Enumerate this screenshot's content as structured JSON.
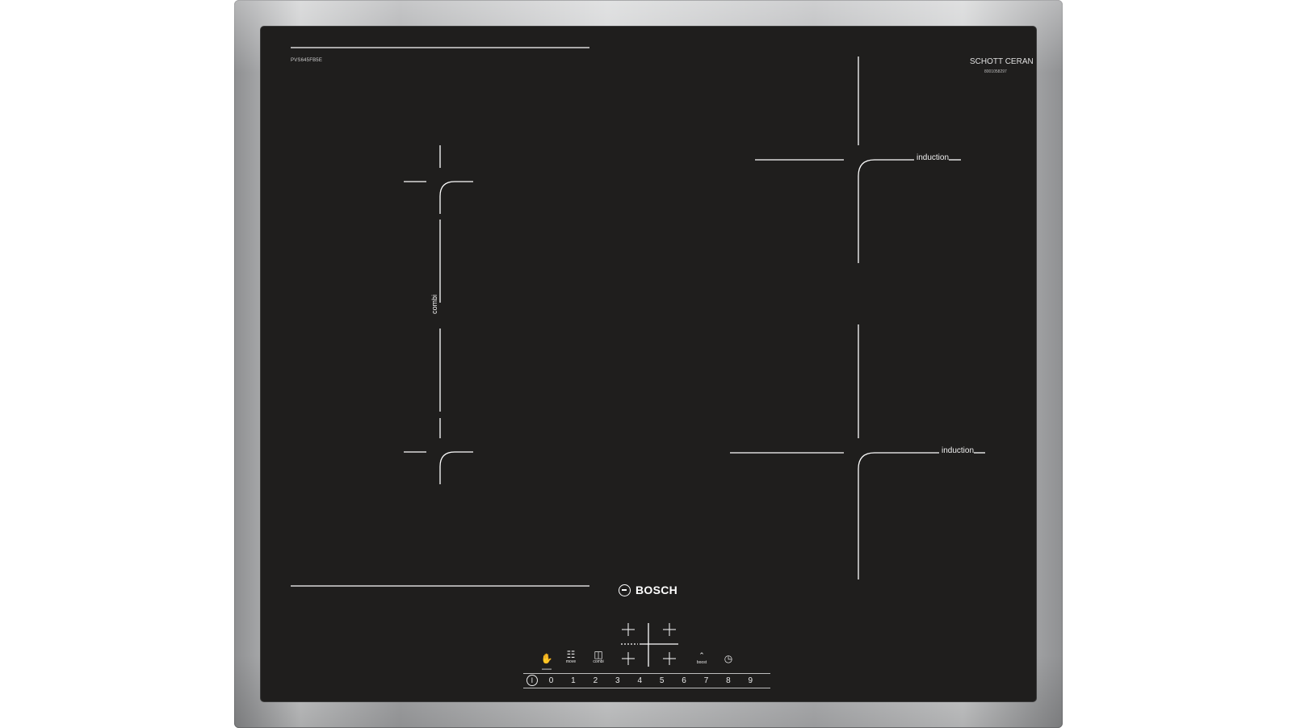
{
  "product": {
    "model": "PVS645FB5E",
    "glass_brand": "SCHOTT CERAN",
    "glass_code": "8001058297",
    "brand": "BOSCH"
  },
  "zones": {
    "left_label": "combi",
    "top_right_label": "induction",
    "bottom_right_label": "induction"
  },
  "controls": {
    "lock_icon": "hand-key-icon",
    "move_label": "move",
    "combi_label": "combi",
    "boost_label": "boost",
    "timer_icon": "clock-icon",
    "power_symbol": "I",
    "levels": [
      "0",
      "1",
      "2",
      "3",
      "4",
      "5",
      "6",
      "7",
      "8",
      "9"
    ]
  },
  "colors": {
    "glass": "#1f1e1d",
    "frame": "#b9babc",
    "lines": "#ffffff"
  }
}
